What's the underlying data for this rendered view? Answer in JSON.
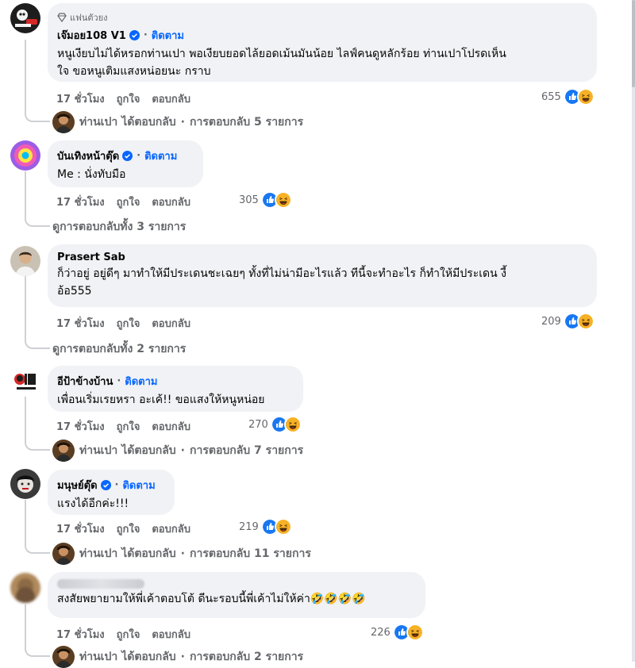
{
  "comments": [
    {
      "badge": "แฟนตัวยง",
      "name": "เจ๊มอย108 V1",
      "verified": true,
      "follow": "ติดตาม",
      "text_lines": [
        "หนูเงียบไม่ได้หรอกท่านเปา พอเงียบยอดไล้ยอดเม้นมันน้อย ไลฟ์คนดูหลักร้อย ท่านเปาโปรดเห็น",
        "ใจ ขอหนูเติมแสงหน่อยนะ กราบ"
      ],
      "time": "17 ชั่วโมง",
      "like": "ถูกใจ",
      "reply": "ตอบกลับ",
      "reaction_count": "655",
      "reply_author": "ท่านเปา",
      "reply_action": "ได้ตอบกลับ",
      "reply_count": "การตอบกลับ 5 รายการ"
    },
    {
      "name": "บันเทิงหน้าตุ๊ด",
      "verified": true,
      "follow": "ติดตาม",
      "text_lines": [
        "Me : นั่งทับมือ"
      ],
      "time": "17 ชั่วโมง",
      "like": "ถูกใจ",
      "reply": "ตอบกลับ",
      "reaction_count": "305",
      "view_all": "ดูการตอบกลับทั้ง 3 รายการ"
    },
    {
      "name": "Prasert Sab",
      "text_lines": [
        "ก็ว่าอยู่ อยู่ดีๆ มาทำให้มีประเดนชะเฉยๆ ทั้งที่ไม่น่ามีอะไรแล้ว ทีนี้จะทำอะไร ก็ทำให้มีประเดน งี้",
        "อ้อ555"
      ],
      "time": "17 ชั่วโมง",
      "like": "ถูกใจ",
      "reply": "ตอบกลับ",
      "reaction_count": "209",
      "view_all": "ดูการตอบกลับทั้ง 2 รายการ"
    },
    {
      "name": "อีป้าข้างบ้าน",
      "follow": "ติดตาม",
      "text_lines": [
        "เพื่อนเริ่มเรยหรา อะเค้!! ขอแสงให้หนูหน่อย"
      ],
      "time": "17 ชั่วโมง",
      "like": "ถูกใจ",
      "reply": "ตอบกลับ",
      "reaction_count": "270",
      "reply_author": "ท่านเปา",
      "reply_action": "ได้ตอบกลับ",
      "reply_count": "การตอบกลับ 7 รายการ"
    },
    {
      "name": "มนุษย์ตุ๊ด",
      "verified": true,
      "follow": "ติดตาม",
      "text_lines": [
        "แรงได้อีกค่ะ!!!"
      ],
      "time": "17 ชั่วโมง",
      "like": "ถูกใจ",
      "reply": "ตอบกลับ",
      "reaction_count": "219",
      "reply_author": "ท่านเปา",
      "reply_action": "ได้ตอบกลับ",
      "reply_count": "การตอบกลับ 11 รายการ"
    },
    {
      "name_blurred": true,
      "text_lines": [
        "สงสัยพยายามให้พี่เค้าตอบโต้ ดีนะรอบนี้พี่เค้าไม่ให้ค่า🤣🤣🤣🤣"
      ],
      "time": "17 ชั่วโมง",
      "like": "ถูกใจ",
      "reply": "ตอบกลับ",
      "reaction_count": "226",
      "reply_author": "ท่านเปา",
      "reply_action": "ได้ตอบกลับ",
      "reply_count": "การตอบกลับ 2 รายการ"
    }
  ],
  "colors": {
    "accent": "#0866ff",
    "bubble": "#f0f2f5",
    "meta": "#65676b",
    "like_blue": "#1877f2",
    "haha_yellow": "#f7b125"
  },
  "icons": {
    "verified": "verified-check-icon",
    "badge": "diamond-icon",
    "like_reaction": "like-reaction-icon",
    "haha_reaction": "haha-reaction-icon"
  }
}
